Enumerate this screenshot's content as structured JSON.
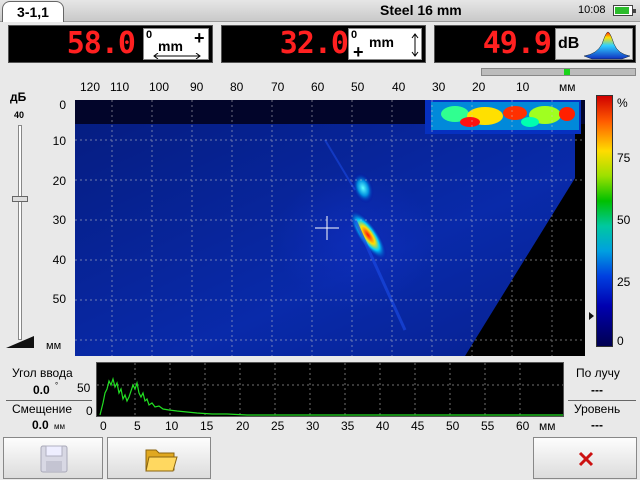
{
  "header": {
    "tab_label": "3-1,1",
    "title": "Steel 16 mm",
    "time": "10:08",
    "battery_level": 0.75
  },
  "readouts": [
    {
      "value": "58.0",
      "unit": "mm",
      "zero": "0"
    },
    {
      "value": "32.0",
      "unit": "mm",
      "zero": "0"
    },
    {
      "value": "49.9",
      "unit": "dB"
    }
  ],
  "scroll": {
    "position": 0.55
  },
  "gain": {
    "label": "дБ",
    "value": "40",
    "level": 0.38
  },
  "bscan": {
    "x_unit": "мм",
    "y_unit": "мм",
    "x_ticks": [
      "120",
      "110",
      "100",
      "90",
      "80",
      "70",
      "60",
      "50",
      "40",
      "30",
      "20",
      "10"
    ],
    "y_ticks": [
      "0",
      "10",
      "20",
      "30",
      "40",
      "50"
    ],
    "colorbar_unit": "%",
    "colorbar_ticks": [
      "75",
      "50",
      "25",
      "0"
    ]
  },
  "ascan": {
    "y_ticks": [
      "50",
      "0"
    ],
    "x_ticks": [
      "0",
      "5",
      "10",
      "15",
      "20",
      "25",
      "30",
      "35",
      "40",
      "45",
      "50",
      "55",
      "60"
    ],
    "x_unit": "мм"
  },
  "left_info": {
    "angle_label": "Угол ввода",
    "angle_value": "0.0",
    "angle_unit": "°",
    "offset_label": "Смещение",
    "offset_value": "0.0",
    "offset_unit": "мм"
  },
  "right_info": {
    "beam_label": "По лучу",
    "beam_value": "---",
    "level_label": "Уровень",
    "level_value": "---"
  },
  "colors": {
    "readout_red": "#ff2020",
    "scan_bg": "#000000",
    "trace_green": "#22dd22",
    "close_red": "#cc1111"
  }
}
